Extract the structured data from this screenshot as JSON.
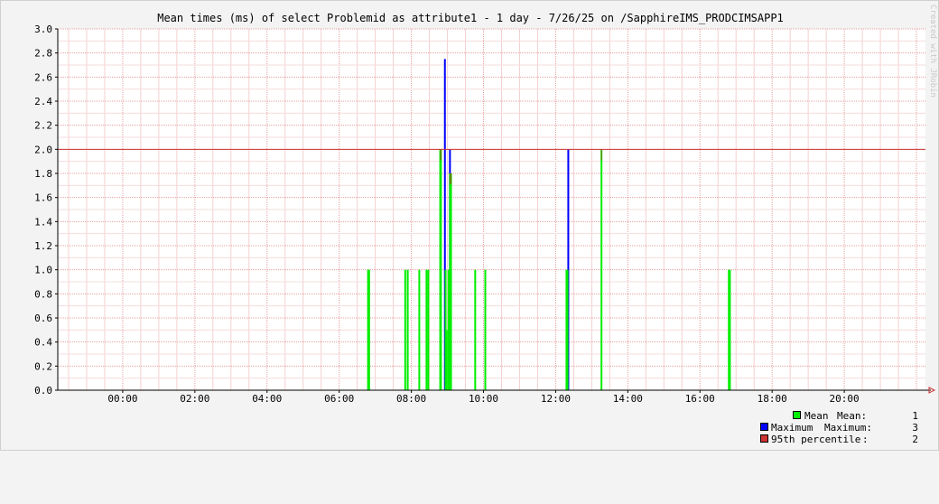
{
  "chart_data": {
    "type": "bar",
    "title": "Mean times (ms) of select Problemid as attribute1 - 1 day - 7/26/25 on /SapphireIMS_PRODCIMSAPP1",
    "x_tick_labels": [
      "00:00",
      "02:00",
      "04:00",
      "06:00",
      "08:00",
      "10:00",
      "12:00",
      "14:00",
      "16:00",
      "18:00",
      "20:00"
    ],
    "y_tick_labels": [
      "0.0",
      "0.2",
      "0.4",
      "0.6",
      "0.8",
      "1.0",
      "1.2",
      "1.4",
      "1.6",
      "1.8",
      "2.0",
      "2.2",
      "2.4",
      "2.6",
      "2.8",
      "3.0"
    ],
    "x_range_hours": [
      -1.8,
      22.25
    ],
    "y_range": [
      0,
      3.0
    ],
    "grid": true,
    "percentile_line": 2.0,
    "series": [
      {
        "name": "Mean",
        "color": "#00ee00",
        "points": [
          [
            6.8,
            1.0
          ],
          [
            6.83,
            1.0
          ],
          [
            7.83,
            1.0
          ],
          [
            7.9,
            1.0
          ],
          [
            8.22,
            1.0
          ],
          [
            8.42,
            1.0
          ],
          [
            8.47,
            1.0
          ],
          [
            8.8,
            2.0
          ],
          [
            8.82,
            2.0
          ],
          [
            8.95,
            1.0
          ],
          [
            8.98,
            0.5
          ],
          [
            9.03,
            1.0
          ],
          [
            9.07,
            1.8
          ],
          [
            9.1,
            1.8
          ],
          [
            9.77,
            1.0
          ],
          [
            10.05,
            1.0
          ],
          [
            12.3,
            1.0
          ],
          [
            12.33,
            1.0
          ],
          [
            13.27,
            2.0
          ],
          [
            16.8,
            1.0
          ],
          [
            16.83,
            1.0
          ]
        ]
      },
      {
        "name": "Maximum",
        "color": "#0000ff",
        "points": [
          [
            8.93,
            2.75
          ],
          [
            9.07,
            2.0
          ],
          [
            12.35,
            2.0
          ]
        ]
      }
    ],
    "legend": [
      {
        "swatch_color": "#00ee00",
        "name": "Mean",
        "stat": "Mean:",
        "value": "1"
      },
      {
        "swatch_color": "#0000ff",
        "name": "Maximum",
        "stat": "Maximum:",
        "value": "3"
      },
      {
        "swatch_color": "#cc3333",
        "name": "95th percentile",
        "stat": ":",
        "value": "2"
      }
    ]
  },
  "watermark": "Created with JRobin"
}
